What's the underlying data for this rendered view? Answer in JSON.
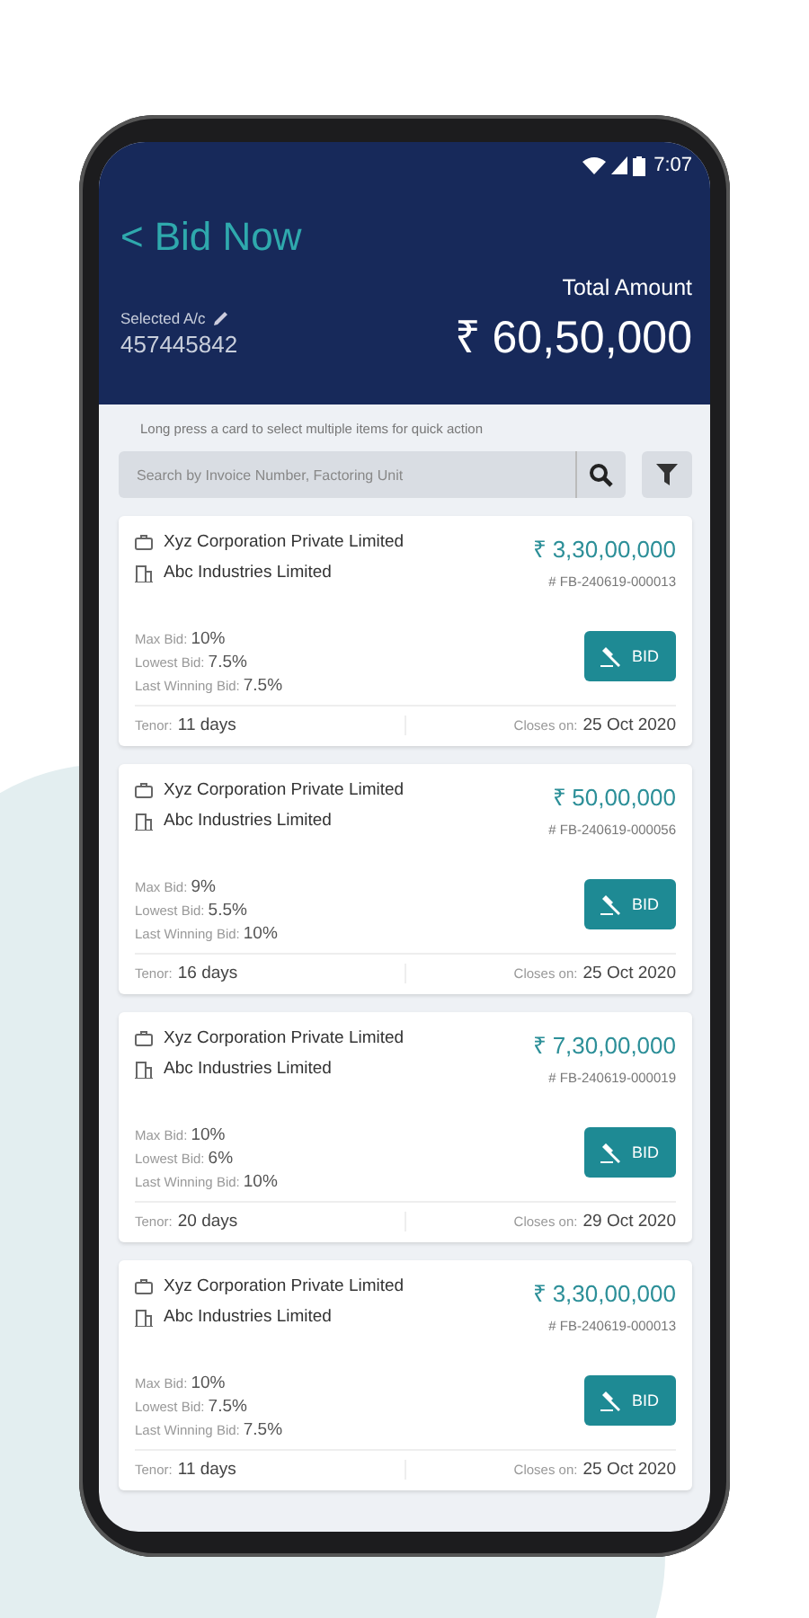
{
  "status_bar": {
    "time": "7:07"
  },
  "header": {
    "back": "<",
    "title": "Bid Now",
    "account_label": "Selected A/c",
    "account_number": "457445842",
    "total_label": "Total Amount",
    "total_amount": "₹ 60,50,000"
  },
  "hint": "Long press a card to select multiple items for quick action",
  "search": {
    "placeholder": "Search by Invoice Number, Factoring Unit"
  },
  "cards": [
    {
      "buyer": "Xyz Corporation Private Limited",
      "seller": "Abc Industries Limited",
      "amount": "₹ 3,30,00,000",
      "ref": "# FB-240619-000013",
      "metrics": [
        {
          "label": "Max Bid:",
          "value": "10%"
        },
        {
          "label": "Lowest Bid:",
          "value": "7.5%"
        },
        {
          "label": "Last Winning Bid:",
          "value": "7.5%"
        }
      ],
      "button": "BID",
      "tenor_label": "Tenor:",
      "tenor": "11 days",
      "closes_label": "Closes on:",
      "closes": "25 Oct 2020"
    },
    {
      "buyer": "Xyz Corporation Private Limited",
      "seller": "Abc Industries Limited",
      "amount": "₹ 50,00,000",
      "ref": "# FB-240619-000056",
      "metrics": [
        {
          "label": "Max Bid:",
          "value": "9%"
        },
        {
          "label": "Lowest Bid:",
          "value": "5.5%"
        },
        {
          "label": "Last Winning Bid:",
          "value": "10%"
        }
      ],
      "button": "BID",
      "tenor_label": "Tenor:",
      "tenor": "16 days",
      "closes_label": "Closes on:",
      "closes": "25 Oct 2020"
    },
    {
      "buyer": "Xyz Corporation Private Limited",
      "seller": "Abc Industries Limited",
      "amount": "₹ 7,30,00,000",
      "ref": "# FB-240619-000019",
      "metrics": [
        {
          "label": "Max Bid:",
          "value": "10%"
        },
        {
          "label": "Lowest Bid:",
          "value": "6%"
        },
        {
          "label": "Last Winning Bid:",
          "value": "10%"
        }
      ],
      "button": "BID",
      "tenor_label": "Tenor:",
      "tenor": "20 days",
      "closes_label": "Closes on:",
      "closes": "29 Oct 2020"
    },
    {
      "buyer": "Xyz Corporation Private Limited",
      "seller": "Abc Industries Limited",
      "amount": "₹ 3,30,00,000",
      "ref": "# FB-240619-000013",
      "metrics": [
        {
          "label": "Max Bid:",
          "value": "10%"
        },
        {
          "label": "Lowest Bid:",
          "value": "7.5%"
        },
        {
          "label": "Last Winning Bid:",
          "value": "7.5%"
        }
      ],
      "button": "BID",
      "tenor_label": "Tenor:",
      "tenor": "11 days",
      "closes_label": "Closes on:",
      "closes": "25 Oct 2020"
    }
  ]
}
